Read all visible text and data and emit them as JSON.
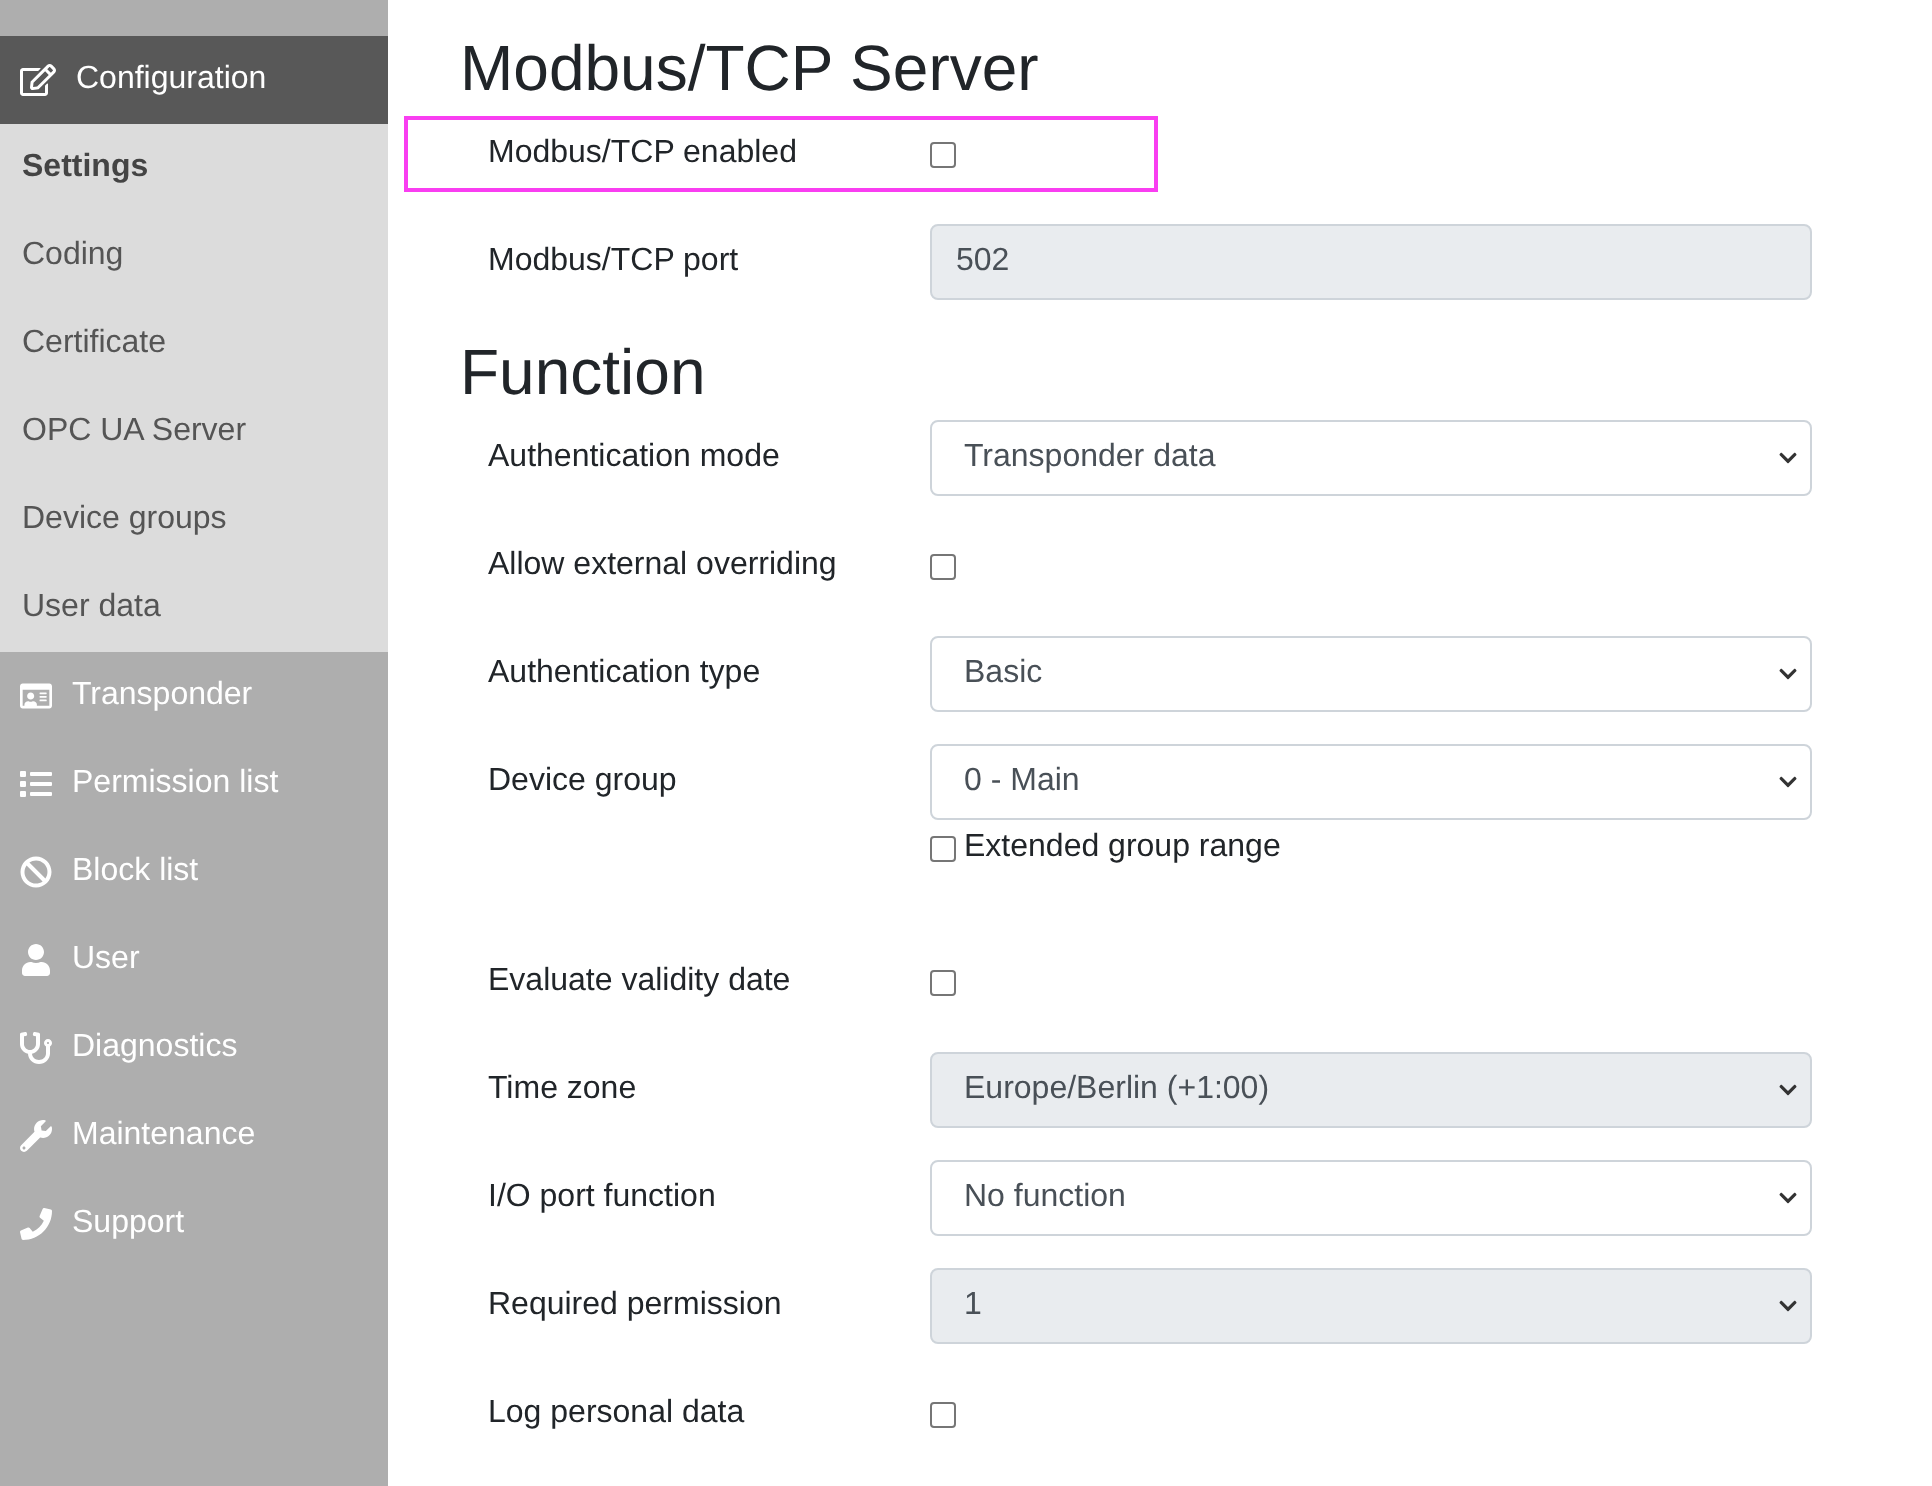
{
  "sidebar": {
    "active": {
      "label": "Configuration",
      "expanded": true
    },
    "subitems": [
      {
        "label": "Settings",
        "selected": true
      },
      {
        "label": "Coding",
        "selected": false
      },
      {
        "label": "Certificate",
        "selected": false
      },
      {
        "label": "OPC UA Server",
        "selected": false
      },
      {
        "label": "Device groups",
        "selected": false
      },
      {
        "label": "User data",
        "selected": false
      }
    ],
    "items": [
      {
        "label": "Transponder"
      },
      {
        "label": "Permission list"
      },
      {
        "label": "Block list"
      },
      {
        "label": "User"
      },
      {
        "label": "Diagnostics"
      },
      {
        "label": "Maintenance"
      },
      {
        "label": "Support"
      }
    ]
  },
  "sections": [
    {
      "title": "Modbus/TCP Server",
      "fields": [
        {
          "label": "Modbus/TCP enabled",
          "kind": "checkbox",
          "checked": false,
          "highlighted": true
        },
        {
          "label": "Modbus/TCP port",
          "kind": "input",
          "value": "502",
          "disabled": true,
          "highlighted": false
        }
      ]
    },
    {
      "title": "Function",
      "fields": [
        {
          "label": "Authentication mode",
          "kind": "select",
          "value": "Transponder data",
          "disabled": false,
          "highlighted": false
        },
        {
          "label": "Allow external overriding",
          "kind": "checkbox",
          "checked": false,
          "highlighted": false
        },
        {
          "label": "Authentication type",
          "kind": "select",
          "value": "Basic",
          "disabled": false,
          "highlighted": false
        },
        {
          "label": "Device group",
          "kind": "select",
          "value": "0 - Main",
          "disabled": false,
          "highlighted": false,
          "extra": {
            "label": "Extended group range",
            "checked": false
          }
        },
        {
          "label": "Evaluate validity date",
          "kind": "checkbox",
          "checked": false,
          "highlighted": false
        },
        {
          "label": "Time zone",
          "kind": "select",
          "value": "Europe/Berlin (+1:00)",
          "disabled": true,
          "highlighted": false
        },
        {
          "label": "I/O port function",
          "kind": "select",
          "value": "No function",
          "disabled": false,
          "highlighted": false
        },
        {
          "label": "Required permission",
          "kind": "select",
          "value": "1",
          "disabled": true,
          "highlighted": false
        },
        {
          "label": "Log personal data",
          "kind": "checkbox",
          "checked": false,
          "highlighted": false
        }
      ]
    }
  ]
}
